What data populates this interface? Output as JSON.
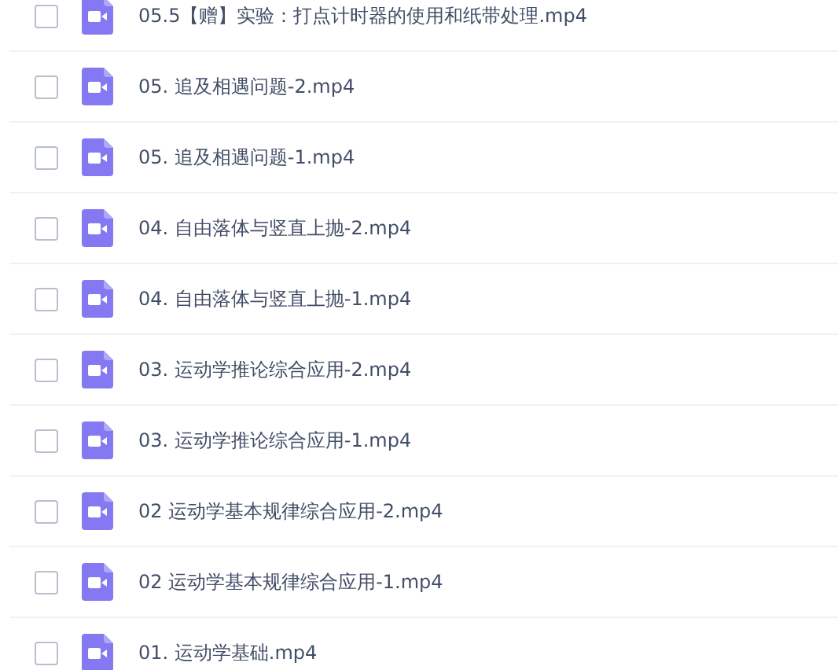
{
  "files": [
    {
      "name": "05.5【赠】实验：打点计时器的使用和纸带处理.mp4",
      "checked": false
    },
    {
      "name": "05. 追及相遇问题-2.mp4",
      "checked": false
    },
    {
      "name": "05. 追及相遇问题-1.mp4",
      "checked": false
    },
    {
      "name": "04. 自由落体与竖直上抛-2.mp4",
      "checked": false
    },
    {
      "name": "04. 自由落体与竖直上抛-1.mp4",
      "checked": false
    },
    {
      "name": "03. 运动学推论综合应用-2.mp4",
      "checked": false
    },
    {
      "name": "03. 运动学推论综合应用-1.mp4",
      "checked": false
    },
    {
      "name": "02 运动学基本规律综合应用-2.mp4",
      "checked": false
    },
    {
      "name": "02 运动学基本规律综合应用-1.mp4",
      "checked": false
    },
    {
      "name": "01. 运动学基础.mp4",
      "checked": false
    }
  ]
}
